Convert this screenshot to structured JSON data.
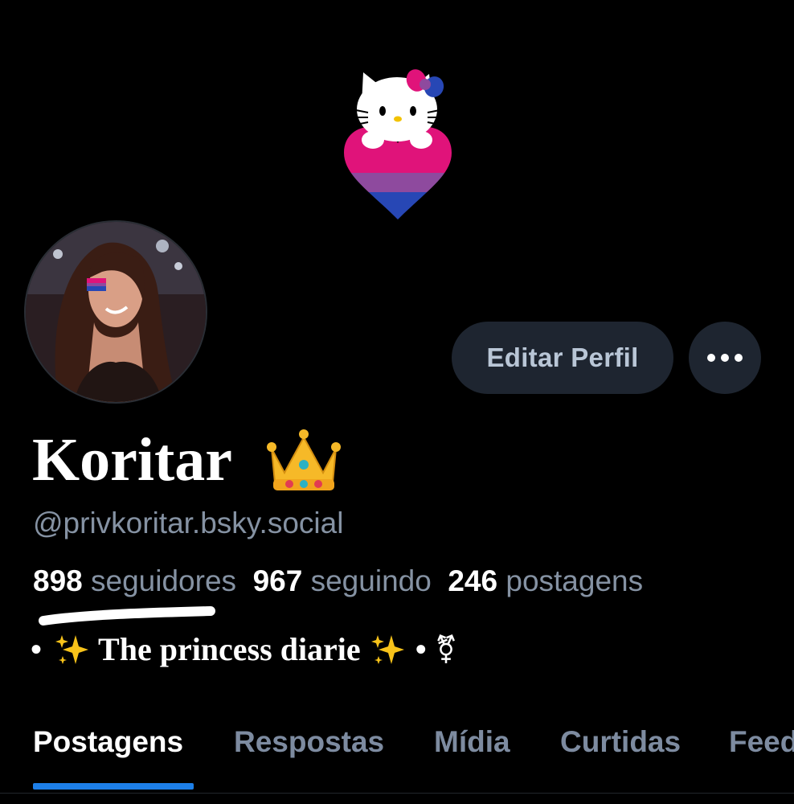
{
  "profile": {
    "display_name": "Koritar",
    "handle": "@privkoritar.bsky.social",
    "bio": {
      "prefix": "•",
      "text": "The princess diarie",
      "suffix": "•",
      "symbol": "⚧"
    }
  },
  "actions": {
    "edit_label": "Editar Perfil"
  },
  "stats": {
    "followers": {
      "count": "898",
      "label": "seguidores"
    },
    "following": {
      "count": "967",
      "label": "seguindo"
    },
    "posts": {
      "count": "246",
      "label": "postagens"
    }
  },
  "tabs": [
    {
      "label": "Postagens",
      "active": true
    },
    {
      "label": "Respostas",
      "active": false
    },
    {
      "label": "Mídia",
      "active": false
    },
    {
      "label": "Curtidas",
      "active": false
    },
    {
      "label": "Feeds",
      "active": false
    }
  ],
  "colors": {
    "background": "#000000",
    "button_bg": "#1e2530",
    "muted_text": "#8592a3",
    "tab_indicator": "#1d7fe8",
    "bi_pink": "#d60270",
    "bi_purple": "#9b4f96",
    "bi_blue": "#0038a8"
  },
  "icons": {
    "banner": "hello-kitty-bi-heart-icon",
    "crown": "crown-emoji-icon",
    "sparkles": "sparkles-emoji-icon",
    "more": "more-dots-icon"
  }
}
